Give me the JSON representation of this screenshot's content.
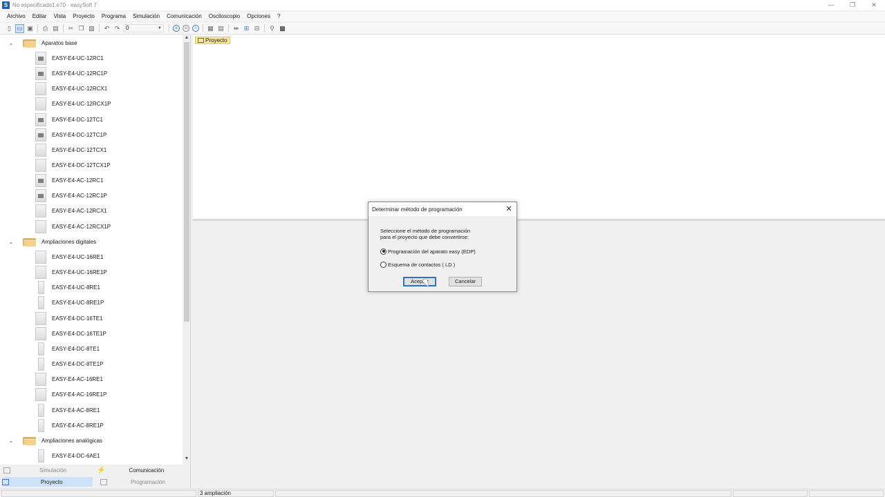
{
  "window": {
    "title": "No especificado1.e70 - easySoft 7",
    "controls": [
      "—",
      "❐",
      "✕"
    ]
  },
  "menu": [
    "Archivo",
    "Editar",
    "Vista",
    "Proyecto",
    "Programa",
    "Simulación",
    "Comunicación",
    "Osciloscopio",
    "Opciones",
    "?"
  ],
  "toolbar": {
    "zoom_value": "0"
  },
  "tree": {
    "groups": [
      {
        "label": "Aparatos base",
        "items": [
          {
            "label": "EASY-E4-UC-12RC1",
            "icon": "display-device-icon"
          },
          {
            "label": "EASY-E4-UC-12RC1P",
            "icon": "display-device-icon"
          },
          {
            "label": "EASY-E4-UC-12RCX1",
            "icon": "device-icon"
          },
          {
            "label": "EASY-E4-UC-12RCX1P",
            "icon": "device-icon"
          },
          {
            "label": "EASY-E4-DC-12TC1",
            "icon": "display-device-icon"
          },
          {
            "label": "EASY-E4-DC-12TC1P",
            "icon": "display-device-icon"
          },
          {
            "label": "EASY-E4-DC-12TCX1",
            "icon": "device-icon"
          },
          {
            "label": "EASY-E4-DC-12TCX1P",
            "icon": "device-icon"
          },
          {
            "label": "EASY-E4-AC-12RC1",
            "icon": "display-device-icon"
          },
          {
            "label": "EASY-E4-AC-12RC1P",
            "icon": "display-device-icon"
          },
          {
            "label": "EASY-E4-AC-12RCX1",
            "icon": "device-icon"
          },
          {
            "label": "EASY-E4-AC-12RCX1P",
            "icon": "device-icon"
          }
        ]
      },
      {
        "label": "Ampliaciones digitales",
        "items": [
          {
            "label": "EASY-E4-UC-16RE1",
            "icon": "device-icon"
          },
          {
            "label": "EASY-E4-UC-16RE1P",
            "icon": "device-icon"
          },
          {
            "label": "EASY-E4-UC-8RE1",
            "icon": "narrow-device-icon"
          },
          {
            "label": "EASY-E4-UC-8RE1P",
            "icon": "narrow-device-icon"
          },
          {
            "label": "EASY-E4-DC-16TE1",
            "icon": "device-icon"
          },
          {
            "label": "EASY-E4-DC-16TE1P",
            "icon": "device-icon"
          },
          {
            "label": "EASY-E4-DC-8TE1",
            "icon": "narrow-device-icon"
          },
          {
            "label": "EASY-E4-DC-8TE1P",
            "icon": "narrow-device-icon"
          },
          {
            "label": "EASY-E4-AC-16RE1",
            "icon": "device-icon"
          },
          {
            "label": "EASY-E4-AC-16RE1P",
            "icon": "device-icon"
          },
          {
            "label": "EASY-E4-AC-8RE1",
            "icon": "narrow-device-icon"
          },
          {
            "label": "EASY-E4-AC-8RE1P",
            "icon": "narrow-device-icon"
          }
        ]
      },
      {
        "label": "Ampliaciones analógicas",
        "items": [
          {
            "label": "EASY-E4-DC-6AE1",
            "icon": "narrow-device-icon"
          }
        ]
      }
    ]
  },
  "bottom_tabs": {
    "simulacion": "Simulación",
    "comunicacion": "Comunicación",
    "proyecto": "Proyecto",
    "programacion": "Programación"
  },
  "project_tab": "Proyecto",
  "status": {
    "cell1": "3 ampliación"
  },
  "dialog": {
    "title": "Determinar método de programación",
    "prompt_line1": "Seleccione el método de programación",
    "prompt_line2": "para el proyecto que debe convertirse:",
    "options": [
      {
        "label": "Programación del aparato easy (EDP)",
        "checked": true
      },
      {
        "label": "Esquema de contactos ( LD )",
        "checked": false
      }
    ],
    "accept_label": "Aceptar",
    "cancel_label": "Cancelar"
  }
}
